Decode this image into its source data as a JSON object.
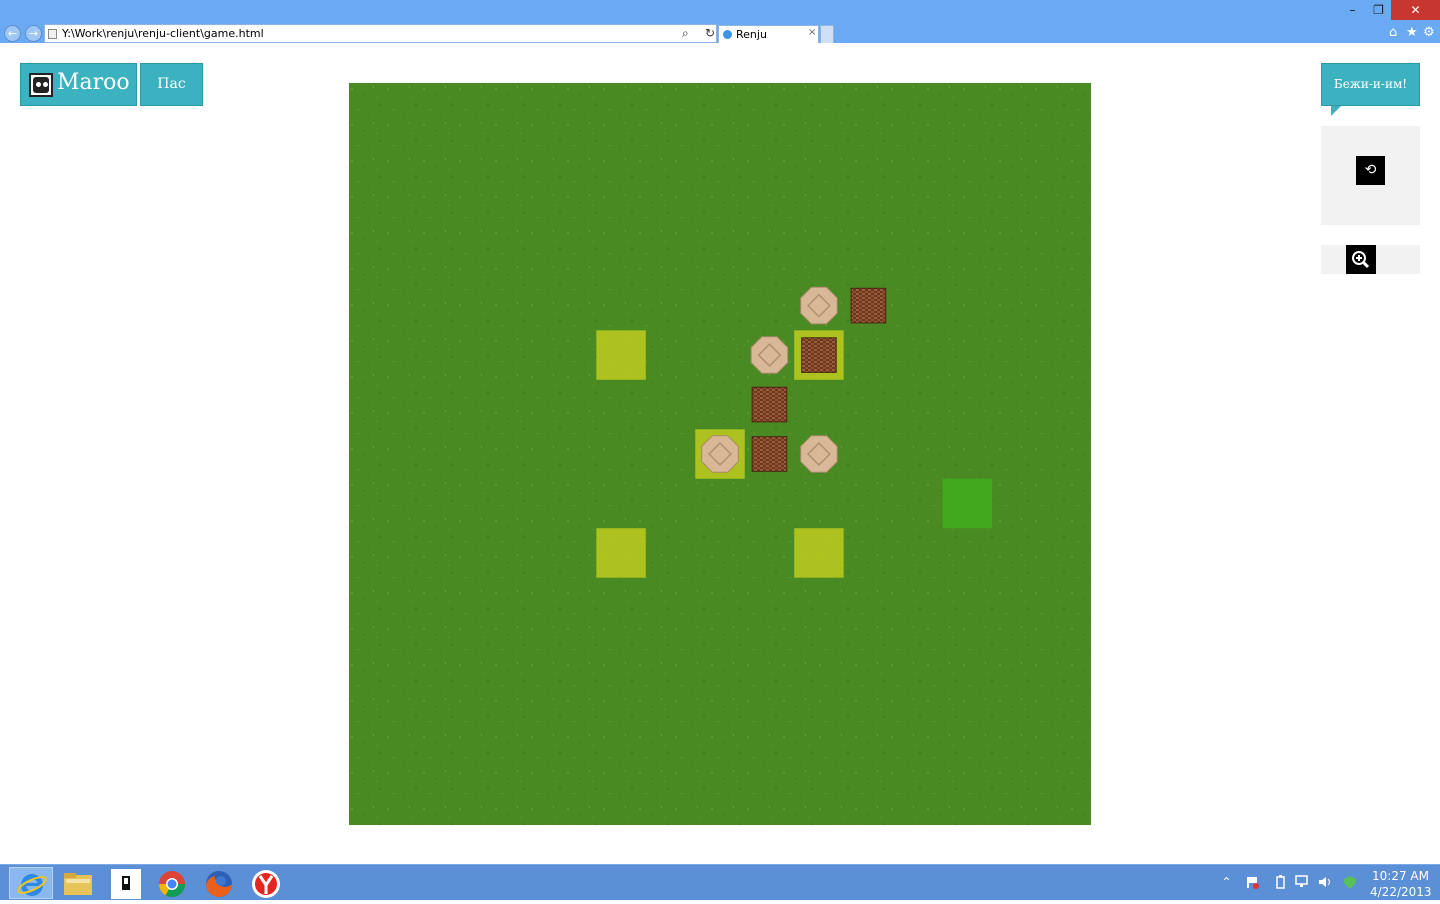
{
  "browser": {
    "address_url": "Y:\\Work\\renju\\renju-client\\game.html",
    "tab_title": "Renju",
    "tab_close": "×",
    "back_glyph": "←",
    "forward_glyph": "→",
    "search_glyph": "⌕",
    "refresh_glyph": "↻",
    "minimize_glyph": "–",
    "maximize_glyph": "❐",
    "close_glyph": "✕",
    "home_glyph": "⌂",
    "favorites_glyph": "★",
    "tools_glyph": "⚙"
  },
  "game": {
    "player_name": "Maroo",
    "pass_label": "Пас",
    "chat_text": "Бежи-и-им!",
    "sync_glyph": "⟲",
    "board": {
      "grid_size": 15,
      "colors": {
        "highlight_yellow": "#b8c81e",
        "highlight_green": "#3fae1a",
        "grass": "#4a8a22",
        "wood_stone": "#7a3e24",
        "tile_stone": "#d8b896"
      },
      "highlights": [
        {
          "col": 5,
          "row": 5,
          "color": "yellow"
        },
        {
          "col": 9,
          "row": 5,
          "color": "yellow"
        },
        {
          "col": 7,
          "row": 7,
          "color": "yellow"
        },
        {
          "col": 5,
          "row": 9,
          "color": "yellow"
        },
        {
          "col": 9,
          "row": 9,
          "color": "yellow"
        },
        {
          "col": 12,
          "row": 8,
          "color": "green"
        }
      ],
      "stones": [
        {
          "col": 9,
          "row": 4,
          "type": "tile"
        },
        {
          "col": 10,
          "row": 4,
          "type": "wood"
        },
        {
          "col": 8,
          "row": 5,
          "type": "tile"
        },
        {
          "col": 9,
          "row": 5,
          "type": "wood"
        },
        {
          "col": 8,
          "row": 6,
          "type": "wood"
        },
        {
          "col": 7,
          "row": 7,
          "type": "tile"
        },
        {
          "col": 8,
          "row": 7,
          "type": "wood"
        },
        {
          "col": 9,
          "row": 7,
          "type": "tile"
        }
      ]
    }
  },
  "taskbar": {
    "apps": [
      "Internet Explorer",
      "File Explorer",
      "Application",
      "Google Chrome",
      "Mozilla Firefox",
      "Yandex Browser"
    ],
    "clock_time": "10:27 AM",
    "clock_date": "4/22/2013",
    "tray_up_glyph": "⌃"
  }
}
